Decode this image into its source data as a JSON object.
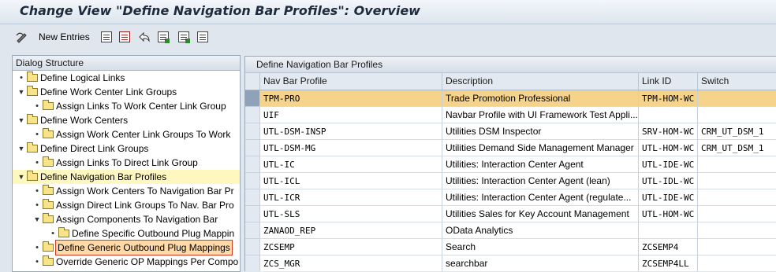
{
  "window": {
    "title": "Change View \"Define Navigation Bar Profiles\": Overview"
  },
  "toolbar": {
    "new_entries_label": "New Entries",
    "icons": [
      "edit-pen-icon",
      "copy-icon",
      "save-icon",
      "undo-icon",
      "select-all-icon",
      "deselect-icon",
      "select-block-icon"
    ]
  },
  "dialog_structure": {
    "header": "Dialog Structure",
    "items": [
      {
        "label": "Define Logical Links",
        "level": 0,
        "marker": "bullet"
      },
      {
        "label": "Define Work Center Link Groups",
        "level": 0,
        "marker": "expanded"
      },
      {
        "label": "Assign Links To Work Center Link Group",
        "level": 1,
        "marker": "bullet"
      },
      {
        "label": "Define Work Centers",
        "level": 0,
        "marker": "expanded"
      },
      {
        "label": "Assign Work Center Link Groups To Work",
        "level": 1,
        "marker": "bullet"
      },
      {
        "label": "Define Direct Link Groups",
        "level": 0,
        "marker": "expanded"
      },
      {
        "label": "Assign Links To Direct Link Group",
        "level": 1,
        "marker": "bullet"
      },
      {
        "label": "Define Navigation Bar Profiles",
        "level": 0,
        "marker": "expanded",
        "selected": true
      },
      {
        "label": "Assign Work Centers To Navigation Bar Pr",
        "level": 1,
        "marker": "bullet"
      },
      {
        "label": "Assign Direct Link Groups To Nav. Bar Pro",
        "level": 1,
        "marker": "bullet"
      },
      {
        "label": "Assign Components To Navigation Bar",
        "level": 1,
        "marker": "expanded"
      },
      {
        "label": "Define Specific Outbound Plug Mappin",
        "level": 2,
        "marker": "bullet"
      },
      {
        "label": "Define Generic Outbound Plug Mappings",
        "level": 1,
        "marker": "bullet",
        "focused": true
      },
      {
        "label": "Override Generic OP Mappings Per Compo",
        "level": 1,
        "marker": "bullet"
      }
    ]
  },
  "table": {
    "title": "Define Navigation Bar Profiles",
    "columns": [
      "Nav Bar Profile",
      "Description",
      "Link ID",
      "Switch"
    ],
    "rows": [
      {
        "profile": "TPM-PRO",
        "description": "Trade Promotion Professional",
        "link_id": "TPM-HOM-WC",
        "switch": "",
        "highlighted": true
      },
      {
        "profile": "UIF",
        "description": "Navbar Profile with UI Framework Test Appli...",
        "link_id": "",
        "switch": ""
      },
      {
        "profile": "UTL-DSM-INSP",
        "description": "Utilities DSM Inspector",
        "link_id": "SRV-HOM-WC",
        "switch": "CRM_UT_DSM_1"
      },
      {
        "profile": "UTL-DSM-MG",
        "description": "Utilities Demand Side Management Manager",
        "link_id": "UTL-HOM-WC",
        "switch": "CRM_UT_DSM_1"
      },
      {
        "profile": "UTL-IC",
        "description": "Utilities: Interaction Center Agent",
        "link_id": "UTL-IDE-WC",
        "switch": ""
      },
      {
        "profile": "UTL-ICL",
        "description": "Utilities: Interaction Center Agent (lean)",
        "link_id": "UTL-IDL-WC",
        "switch": ""
      },
      {
        "profile": "UTL-ICR",
        "description": "Utilities: Interaction Center Agent (regulate...",
        "link_id": "UTL-IDE-WC",
        "switch": ""
      },
      {
        "profile": "UTL-SLS",
        "description": "Utilities Sales for Key Account Management",
        "link_id": "UTL-HOM-WC",
        "switch": ""
      },
      {
        "profile": "ZANAOD_REP",
        "description": "OData Analytics",
        "link_id": "",
        "switch": ""
      },
      {
        "profile": "ZCSEMP",
        "description": "Search",
        "link_id": "ZCSEMP4",
        "switch": ""
      },
      {
        "profile": "ZCS_MGR",
        "description": "searchbar",
        "link_id": "ZCSEMP4LL",
        "switch": ""
      }
    ]
  }
}
